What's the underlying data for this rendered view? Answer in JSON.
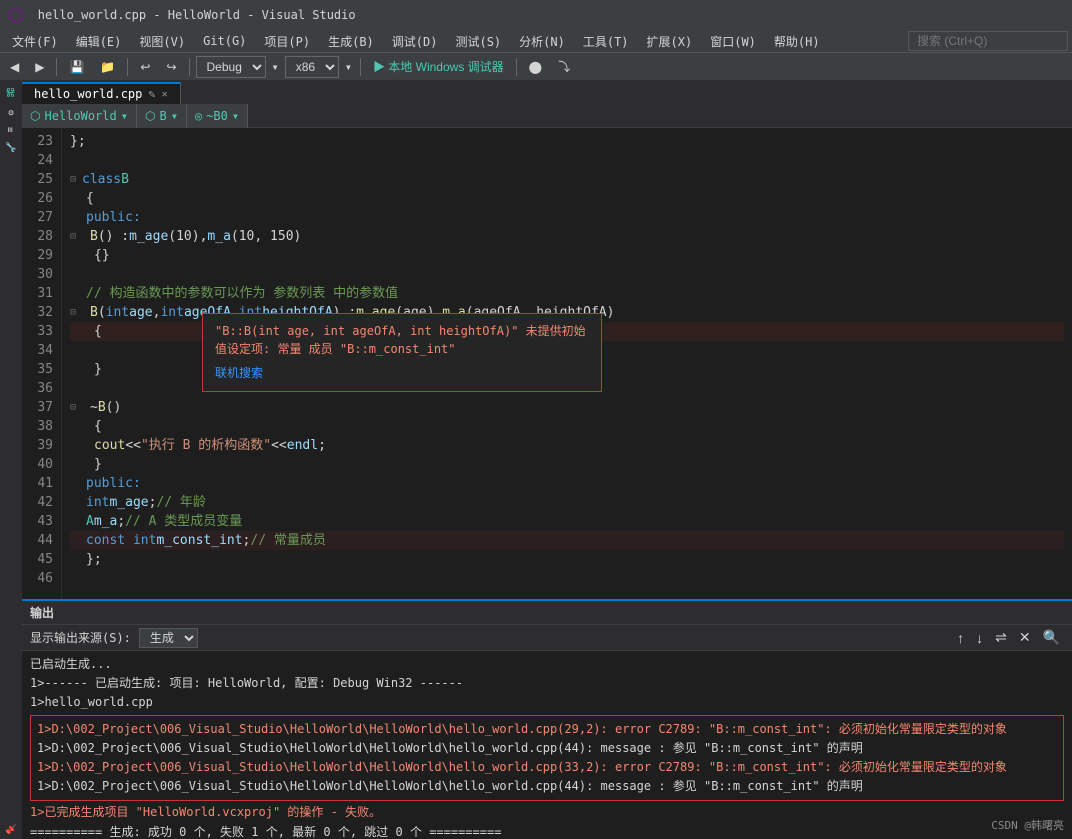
{
  "titlebar": {
    "logo": "▶",
    "menus": [
      "文件(F)",
      "编辑(E)",
      "视图(V)",
      "Git(G)",
      "项目(P)",
      "生成(B)",
      "调试(D)",
      "测试(S)",
      "分析(N)",
      "工具(T)",
      "扩展(X)",
      "窗口(W)",
      "帮助(H)"
    ]
  },
  "toolbar": {
    "config": "Debug",
    "platform": "x86",
    "run_label": "▶ 本地 Windows 调试器",
    "search_placeholder": "搜索 (Ctrl+Q)"
  },
  "tabs": [
    {
      "label": "hello_world.cpp",
      "active": true
    }
  ],
  "nav": {
    "left": "HelloWorld",
    "middle": "B",
    "right": "~B0"
  },
  "code": {
    "lines": [
      {
        "num": 23,
        "content": "    };"
      },
      {
        "num": 24,
        "content": ""
      },
      {
        "num": 25,
        "content": "class B",
        "fold": true
      },
      {
        "num": 26,
        "content": "    {"
      },
      {
        "num": 27,
        "content": "    public:"
      },
      {
        "num": 28,
        "content": "        B() : m_age(10), m_a(10, 150)",
        "fold": true
      },
      {
        "num": 29,
        "content": "        {}"
      },
      {
        "num": 30,
        "content": ""
      },
      {
        "num": 31,
        "content": "        // 构造函数中的参数可以作为 参数列表 中的参数值"
      },
      {
        "num": 32,
        "content": "        B(int age, int ageOfA, int heightOfA) : m_age(age), m_a(ageOfA, heightOfA)",
        "fold": true
      },
      {
        "num": 33,
        "content": "        {"
      },
      {
        "num": 34,
        "content": ""
      },
      {
        "num": 35,
        "content": "        }"
      },
      {
        "num": 36,
        "content": ""
      },
      {
        "num": 37,
        "content": "        ~B()",
        "fold": true
      },
      {
        "num": 38,
        "content": "        {"
      },
      {
        "num": 39,
        "content": "            cout << \"执行 B 的析构函数\" << endl;"
      },
      {
        "num": 40,
        "content": "        }"
      },
      {
        "num": 41,
        "content": "    public:"
      },
      {
        "num": 42,
        "content": "        int m_age;    // 年龄"
      },
      {
        "num": 43,
        "content": "        A m_a;        // A 类型成员变量"
      },
      {
        "num": 44,
        "content": "        const int m_const_int;  // 常量成员"
      },
      {
        "num": 45,
        "content": "    };"
      },
      {
        "num": 46,
        "content": ""
      }
    ]
  },
  "error_popup": {
    "text": "\"B::B(int age, int ageOfA, int heightOfA)\" 未提供初始值设定项: 常量 成员 \"B::m_const_int\"",
    "link": "联机搜索"
  },
  "output": {
    "header": "输出",
    "source_label": "显示输出来源(S):",
    "source_value": "生成",
    "lines": [
      "已启动生成...",
      "1>------ 已启动生成: 项目: HelloWorld, 配置: Debug Win32 ------",
      "1>hello_world.cpp",
      "1>D:\\002_Project\\006_Visual_Studio\\HelloWorld\\HelloWorld\\hello_world.cpp(29,2): error C2789: \"B::m_const_int\": 必须初始化常量限定类型的对象",
      "1>D:\\002_Project\\006_Visual_Studio\\HelloWorld\\HelloWorld\\hello_world.cpp(44): message : 参见 \"B::m_const_int\" 的声明",
      "1>D:\\002_Project\\006_Visual_Studio\\HelloWorld\\HelloWorld\\hello_world.cpp(33,2): error C2789: \"B::m_const_int\": 必须初始化常量限定类型的对象",
      "1>D:\\002_Project\\006_Visual_Studio\\HelloWorld\\HelloWorld\\hello_world.cpp(44): message : 参见 \"B::m_const_int\" 的声明",
      "1>已完成生成项目 \"HelloWorld.vcxproj\" 的操作 - 失败。",
      "========== 生成: 成功 0 个, 失败 1 个, 最新 0 个, 跳过 0 个 =========="
    ]
  },
  "watermark": "CSDN @韩曙亮"
}
